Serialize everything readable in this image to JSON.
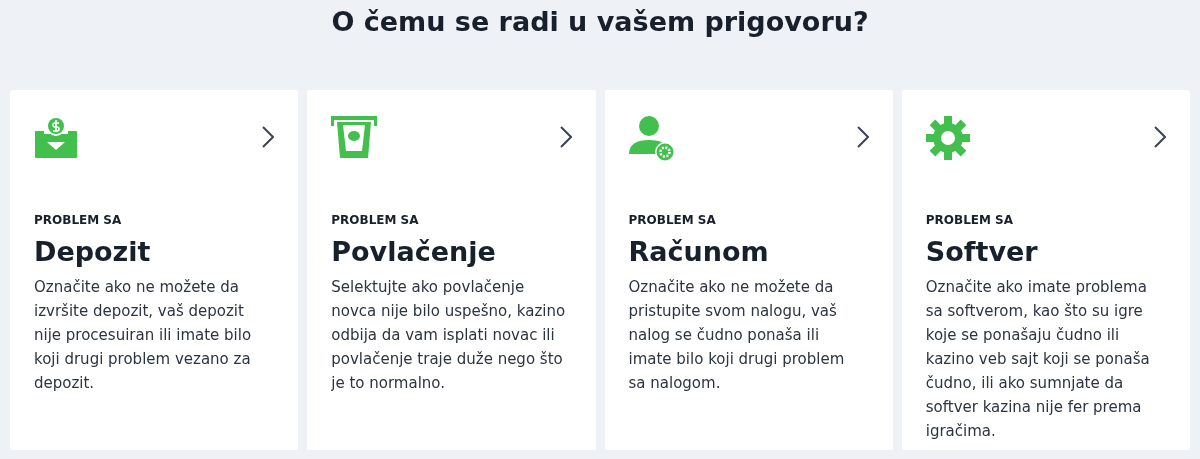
{
  "heading": "O čemu se radi u vašem prigovoru?",
  "cards": [
    {
      "kind": "deposit",
      "eyebrow": "PROBLEM SA",
      "title": "Depozit",
      "text": "Označite ako ne možete da izvršite depozit, vaš depozit nije procesuiran ili imate bilo koji drugi problem vezano za depozit."
    },
    {
      "kind": "withdrawal",
      "eyebrow": "PROBLEM SA",
      "title": "Povlačenje",
      "text": "Selektujte ako povlačenje novca nije bilo uspešno, kazino odbija da vam isplati novac ili povlačenje traje duže nego što je to normalno."
    },
    {
      "kind": "account",
      "eyebrow": "PROBLEM SA",
      "title": "Računom",
      "text": "Označite ako ne možete da pristupite svom nalogu, vaš nalog se čudno ponaša ili imate bilo koji drugi problem sa nalogom."
    },
    {
      "kind": "software",
      "eyebrow": "PROBLEM SA",
      "title": "Softver",
      "text": "Označite ako imate problema sa softverom, kao što su igre koje se ponašaju čudno ili kazino veb sajt koji se ponaša čudno, ili ako sumnjate da softver kazina nije fer prema igračima."
    }
  ]
}
